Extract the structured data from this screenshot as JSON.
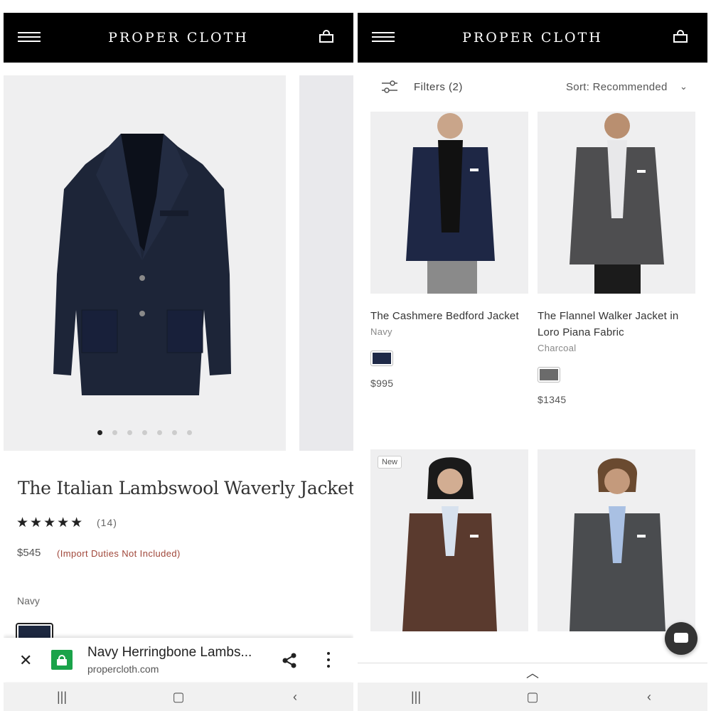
{
  "left": {
    "brand": "PROPER CLOTH",
    "product": {
      "title": "The Italian Lambswool Waverly Jacket",
      "stars": "★★★★★",
      "reviews": "(14)",
      "price": "$545",
      "duties_note": "(Import Duties Not Included)",
      "color_label": "Navy",
      "image_count": 7,
      "active_image": 1
    },
    "browser_bar": {
      "page_title": "Navy Herringbone Lambs...",
      "url": "propercloth.com"
    }
  },
  "right": {
    "brand": "PROPER CLOTH",
    "filters_label": "Filters (2)",
    "sort_label": "Sort: Recommended",
    "products": [
      {
        "name": "The Cashmere Bedford Jacket",
        "color": "Navy",
        "price": "$995",
        "swatch": "#1f2a48"
      },
      {
        "name": "The Flannel Walker Jacket in Loro Piana Fabric",
        "color": "Charcoal",
        "price": "$1345",
        "swatch": "#6b6b6b"
      },
      {
        "badge": "New",
        "swatch": "#4a3026"
      },
      {
        "swatch": "#4b4d4f"
      }
    ]
  },
  "nav_glyphs": {
    "recents": "|||",
    "home": "▢",
    "back": "‹"
  },
  "colors": {
    "header_bg": "#000000",
    "accent_red": "#a0473a",
    "lock_green": "#1aa34a"
  }
}
